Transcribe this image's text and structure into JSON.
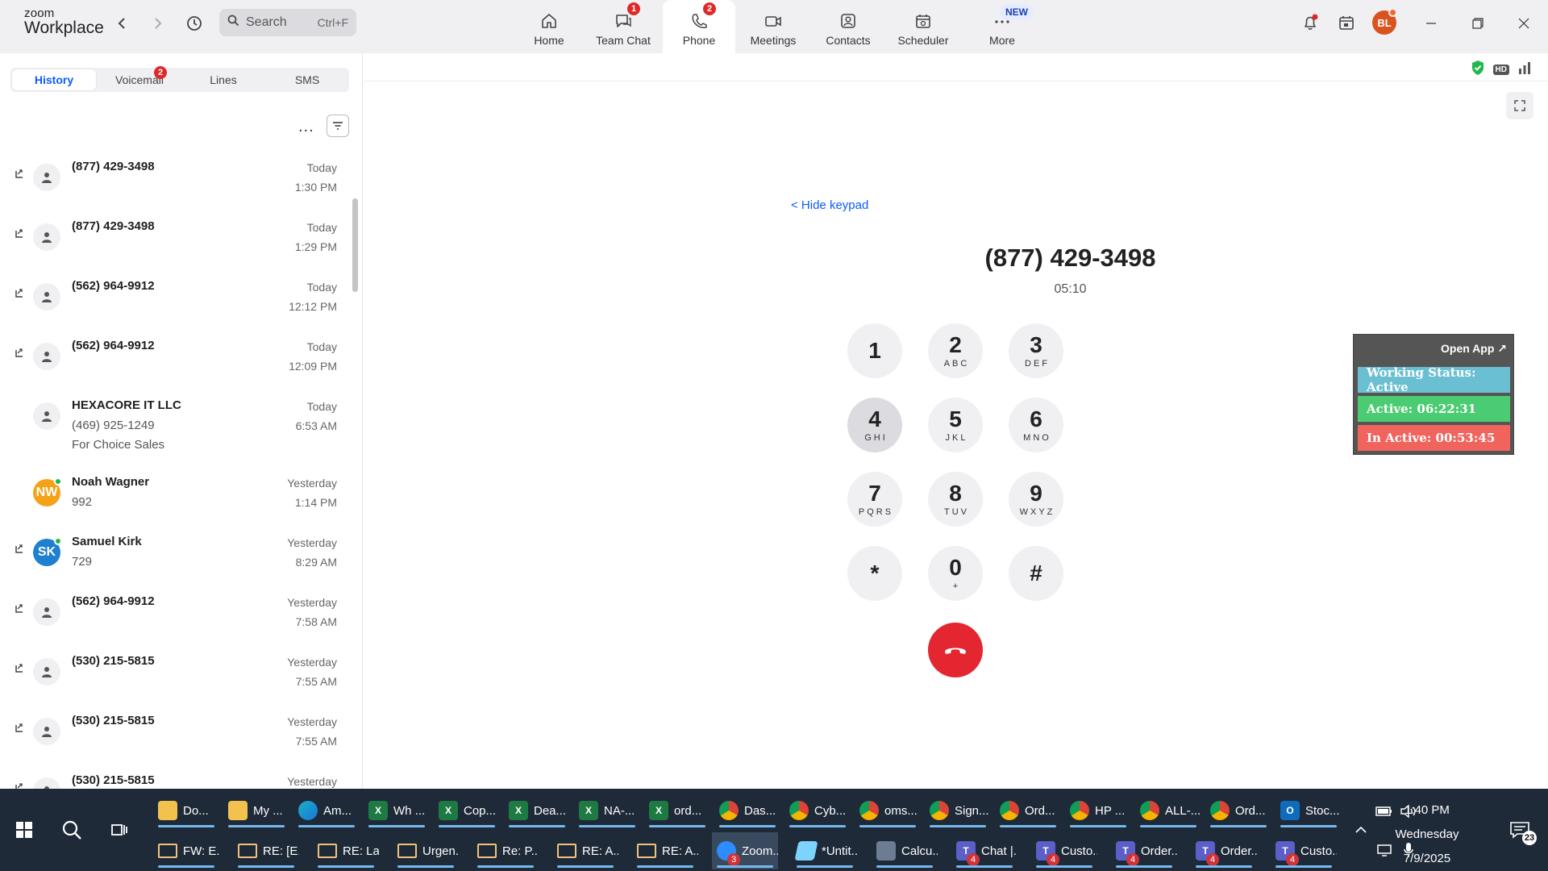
{
  "app": {
    "brand_line1": "zoom",
    "brand_line2": "Workplace",
    "search_placeholder": "Search",
    "search_shortcut": "Ctrl+F"
  },
  "nav_tabs": [
    {
      "label": "Home",
      "icon": "home-icon"
    },
    {
      "label": "Team Chat",
      "icon": "chat-icon",
      "badge": "1"
    },
    {
      "label": "Phone",
      "icon": "phone-icon",
      "badge": "2",
      "active": true
    },
    {
      "label": "Meetings",
      "icon": "video-icon"
    },
    {
      "label": "Contacts",
      "icon": "contacts-icon"
    },
    {
      "label": "Scheduler",
      "icon": "calendar-icon"
    },
    {
      "label": "More",
      "icon": "more-icon",
      "new_label": "NEW"
    }
  ],
  "user": {
    "initials": "BL",
    "avatar_color": "#d9531e"
  },
  "left": {
    "subtabs": [
      {
        "label": "History",
        "active": true
      },
      {
        "label": "Voicemail",
        "badge": "2"
      },
      {
        "label": "Lines"
      },
      {
        "label": "SMS"
      }
    ],
    "more_label": "...",
    "calls": [
      {
        "name": "(877) 429-3498",
        "day": "Today",
        "time": "1:30 PM",
        "arrow": true
      },
      {
        "name": "(877) 429-3498",
        "day": "Today",
        "time": "1:29 PM",
        "arrow": true
      },
      {
        "name": "(562) 964-9912",
        "day": "Today",
        "time": "12:12 PM",
        "arrow": true
      },
      {
        "name": "(562) 964-9912",
        "day": "Today",
        "time": "12:09 PM",
        "arrow": true
      },
      {
        "name": "HEXACORE IT LLC",
        "sub1": "(469) 925-1249",
        "sub2": "For Choice Sales",
        "day": "Today",
        "time": "6:53 AM",
        "arrow": false
      },
      {
        "name": "Noah Wagner",
        "sub1": "992",
        "day": "Yesterday",
        "time": "1:14 PM",
        "arrow": false,
        "initials": "NW",
        "avatar_color": "#f5a21b"
      },
      {
        "name": "Samuel Kirk",
        "sub1": "729",
        "day": "Yesterday",
        "time": "8:29 AM",
        "arrow": true,
        "initials": "SK",
        "avatar_color": "#1f7fd1"
      },
      {
        "name": "(562) 964-9912",
        "day": "Yesterday",
        "time": "7:58 AM",
        "arrow": true
      },
      {
        "name": "(530) 215-5815",
        "day": "Yesterday",
        "time": "7:55 AM",
        "arrow": true
      },
      {
        "name": "(530) 215-5815",
        "day": "Yesterday",
        "time": "7:55 AM",
        "arrow": true
      },
      {
        "name": "(530) 215-5815",
        "day": "Yesterday",
        "time": "",
        "arrow": true
      }
    ]
  },
  "call": {
    "hide_keypad": "< Hide keypad",
    "number": "(877) 429-3498",
    "duration": "05:10",
    "keys": [
      {
        "digit": "1",
        "letters": ""
      },
      {
        "digit": "2",
        "letters": "ABC"
      },
      {
        "digit": "3",
        "letters": "DEF"
      },
      {
        "digit": "4",
        "letters": "GHI",
        "pressed": true
      },
      {
        "digit": "5",
        "letters": "JKL"
      },
      {
        "digit": "6",
        "letters": "MNO"
      },
      {
        "digit": "7",
        "letters": "PQRS"
      },
      {
        "digit": "8",
        "letters": "TUV"
      },
      {
        "digit": "9",
        "letters": "WXYZ"
      },
      {
        "digit": "*",
        "letters": ""
      },
      {
        "digit": "0",
        "letters": "+"
      },
      {
        "digit": "#",
        "letters": ""
      }
    ],
    "hd_label": "HD"
  },
  "widget": {
    "open_app": "Open App ↗",
    "working_status": "Working Status: Active",
    "active": "Active: 06:22:31",
    "inactive": "In Active: 00:53:45"
  },
  "taskbar": {
    "row1": [
      {
        "label": "Do...",
        "icon": "folder"
      },
      {
        "label": "My ...",
        "icon": "folder"
      },
      {
        "label": "Am...",
        "icon": "edge"
      },
      {
        "label": "Wh ...",
        "icon": "excel"
      },
      {
        "label": "Cop...",
        "icon": "excel"
      },
      {
        "label": "Dea...",
        "icon": "excel"
      },
      {
        "label": "NA-...",
        "icon": "excel"
      },
      {
        "label": "ord...",
        "icon": "excel"
      },
      {
        "label": "Das...",
        "icon": "chrome"
      },
      {
        "label": "Cyb...",
        "icon": "chrome"
      },
      {
        "label": "oms...",
        "icon": "chrome"
      },
      {
        "label": "Sign...",
        "icon": "chrome"
      },
      {
        "label": "Ord...",
        "icon": "chrome"
      },
      {
        "label": "HP ...",
        "icon": "chrome"
      },
      {
        "label": "ALL-...",
        "icon": "chrome"
      },
      {
        "label": "Ord...",
        "icon": "chrome"
      },
      {
        "label": "Stoc...",
        "icon": "outlook"
      }
    ],
    "row2": [
      {
        "label": "FW: E...",
        "icon": "mail"
      },
      {
        "label": "RE: [E...",
        "icon": "mail"
      },
      {
        "label": "RE: La...",
        "icon": "mail"
      },
      {
        "label": "Urgen...",
        "icon": "mail"
      },
      {
        "label": "Re: P...",
        "icon": "mail"
      },
      {
        "label": "RE: A...",
        "icon": "mail"
      },
      {
        "label": "RE: A...",
        "icon": "mail"
      },
      {
        "label": "Zoom...",
        "icon": "zoom",
        "count": "3",
        "active": true
      },
      {
        "label": "*Untit...",
        "icon": "note"
      },
      {
        "label": "Calcu...",
        "icon": "calc"
      },
      {
        "label": "Chat |...",
        "icon": "teams",
        "count": "4"
      },
      {
        "label": "Custo...",
        "icon": "teams",
        "count": "4"
      },
      {
        "label": "Order...",
        "icon": "teams",
        "count": "4"
      },
      {
        "label": "Order...",
        "icon": "teams",
        "count": "4"
      },
      {
        "label": "Custo...",
        "icon": "teams",
        "count": "4"
      }
    ],
    "clock_time": "1:40 PM",
    "clock_day": "Wednesday",
    "clock_date": "7/9/2025",
    "notifications": "23"
  }
}
